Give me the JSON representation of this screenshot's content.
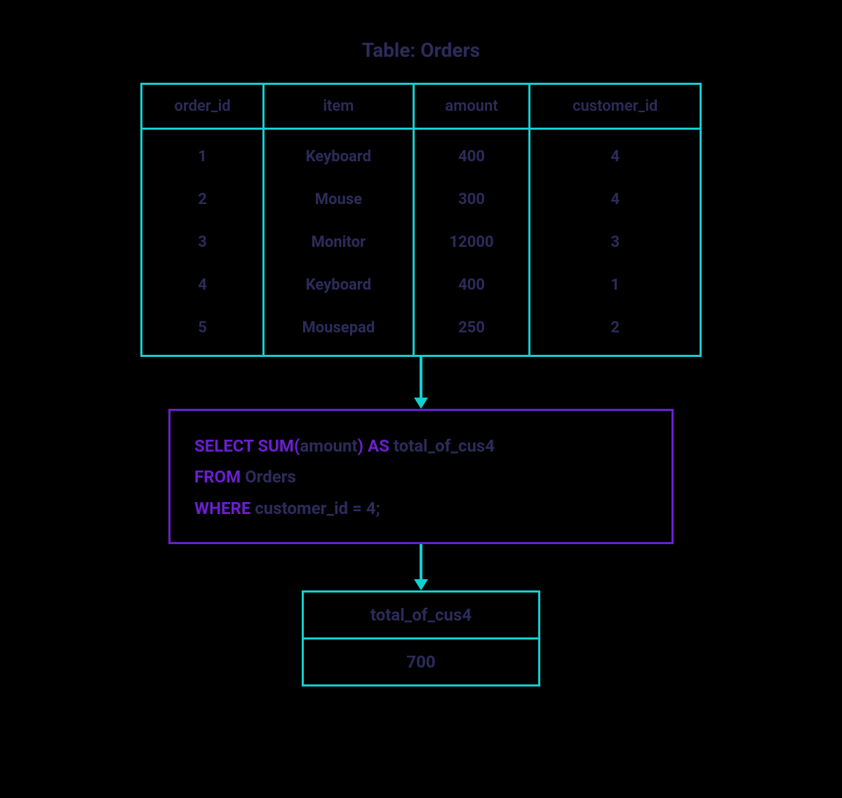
{
  "title": "Table: Orders",
  "orders": {
    "columns": [
      "order_id",
      "item",
      "amount",
      "customer_id"
    ],
    "rows": [
      {
        "order_id": "1",
        "item": "Keyboard",
        "amount": "400",
        "customer_id": "4"
      },
      {
        "order_id": "2",
        "item": "Mouse",
        "amount": "300",
        "customer_id": "4"
      },
      {
        "order_id": "3",
        "item": "Monitor",
        "amount": "12000",
        "customer_id": "3"
      },
      {
        "order_id": "4",
        "item": "Keyboard",
        "amount": "400",
        "customer_id": "1"
      },
      {
        "order_id": "5",
        "item": "Mousepad",
        "amount": "250",
        "customer_id": "2"
      }
    ]
  },
  "sql": {
    "kw_select": "SELECT SUM(",
    "arg1": "amount",
    "kw_as": ") AS ",
    "alias": "total_of_cus4",
    "kw_from": "FROM ",
    "table": "Orders",
    "kw_where": "WHERE ",
    "cond": "customer_id = 4;"
  },
  "result": {
    "header": "total_of_cus4",
    "value": "700"
  }
}
